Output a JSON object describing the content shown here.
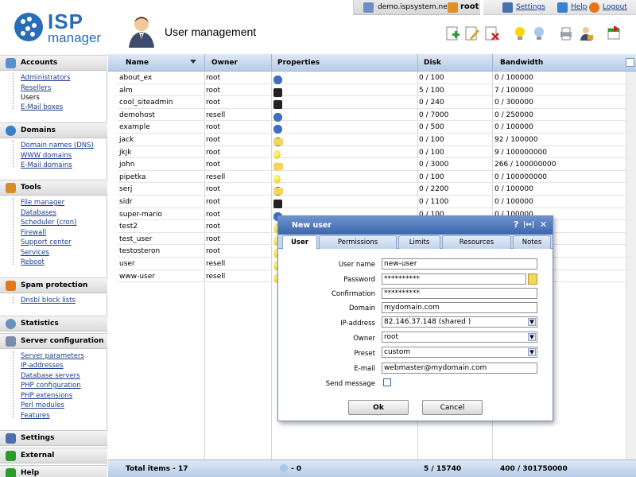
{
  "header": {
    "logo_line1": "ISP",
    "logo_line2": "manager",
    "server": "demo.ispsystem.net ::",
    "user": "root",
    "links": {
      "settings": "Settings",
      "help": "Help",
      "logout": "Logout"
    },
    "page_title": "User management"
  },
  "sidebar": {
    "sections": [
      {
        "title": "Accounts",
        "items": [
          "Administrators",
          "Resellers",
          "Users",
          "E-Mail boxes"
        ],
        "current": "Users"
      },
      {
        "title": "Domains",
        "items": [
          "Domain names (DNS)",
          "WWW domains",
          "E-Mail domains"
        ]
      },
      {
        "title": "Tools",
        "items": [
          "File manager",
          "Databases",
          "Scheduler (cron)",
          "Firewall",
          "Support center",
          "Services",
          "Reboot"
        ]
      },
      {
        "title": "Spam protection",
        "items": [
          "Dnsbl block lists"
        ]
      },
      {
        "title": "Statistics",
        "items": []
      },
      {
        "title": "Server configuration",
        "items": [
          "Server parameters",
          "IP-addresses",
          "Database servers",
          "PHP configuration",
          "PHP extensions",
          "Perl modules",
          "Features"
        ]
      },
      {
        "title": "Settings",
        "items": []
      },
      {
        "title": "External",
        "items": []
      },
      {
        "title": "Help",
        "items": []
      }
    ]
  },
  "grid": {
    "columns": [
      "Name",
      "Owner",
      "Properties",
      "Disk",
      "Bandwidth"
    ],
    "rows": [
      {
        "name": "about_ex",
        "owner": "root",
        "props": [
          "bulb",
          "cgi",
          "php",
          "ssi"
        ],
        "disk": "0 / 100",
        "bw": "0 / 100000"
      },
      {
        "name": "alm",
        "owner": "root",
        "props": [
          "bulb",
          "cgi",
          "php",
          "ssi",
          "ssl",
          "ssh"
        ],
        "disk": "5 / 100",
        "bw": "7 / 100000"
      },
      {
        "name": "cool_siteadmin",
        "owner": "root",
        "props": [
          "bulb",
          "cgi",
          "php",
          "ssi",
          "ssl",
          "ssh"
        ],
        "disk": "0 / 240",
        "bw": "0 / 300000"
      },
      {
        "name": "demohost",
        "owner": "resell",
        "props": [
          "bulb",
          "cgi",
          "php",
          "ssi"
        ],
        "disk": "0 / 7000",
        "bw": "0 / 250000"
      },
      {
        "name": "example",
        "owner": "root",
        "props": [
          "bulb",
          "cgi",
          "php",
          "ssi"
        ],
        "disk": "0 / 500",
        "bw": "0 / 100000"
      },
      {
        "name": "jack",
        "owner": "root",
        "props": [
          "bulb",
          "cgi",
          "php",
          "ssi",
          "fold"
        ],
        "disk": "0 / 100",
        "bw": "92 / 100000"
      },
      {
        "name": "jkjk",
        "owner": "root",
        "props": [
          "bulb"
        ],
        "disk": "0 / 100",
        "bw": "9 / 100000000"
      },
      {
        "name": "john",
        "owner": "root",
        "props": [
          "bulb",
          "fold"
        ],
        "disk": "0 / 3000",
        "bw": "266 / 100000000"
      },
      {
        "name": "pipetka",
        "owner": "resell",
        "props": [
          "bulb"
        ],
        "disk": "0 / 100",
        "bw": "0 / 100000000"
      },
      {
        "name": "serj",
        "owner": "root",
        "props": [
          "bulb",
          "cgi",
          "php",
          "ssi",
          "fold"
        ],
        "disk": "0 / 2200",
        "bw": "0 / 100000"
      },
      {
        "name": "sidr",
        "owner": "root",
        "props": [
          "bulb",
          "cgi",
          "php",
          "ssi",
          "ssl",
          "ssh"
        ],
        "disk": "0 / 1100",
        "bw": "0 / 100000"
      },
      {
        "name": "super-mario",
        "owner": "root",
        "props": [
          "bulb",
          "cgi",
          "php",
          "ssi"
        ],
        "disk": "0 / 100",
        "bw": "0 / 100000"
      },
      {
        "name": "test2",
        "owner": "root",
        "props": [
          "bulb"
        ],
        "disk": "",
        "bw": ""
      },
      {
        "name": "test_user",
        "owner": "root",
        "props": [
          "bulb"
        ],
        "disk": "",
        "bw": ""
      },
      {
        "name": "testosteron",
        "owner": "root",
        "props": [
          "bulb"
        ],
        "disk": "",
        "bw": ""
      },
      {
        "name": "user",
        "owner": "resell",
        "props": [
          "bulb"
        ],
        "disk": "",
        "bw": ""
      },
      {
        "name": "www-user",
        "owner": "resell",
        "props": [
          "bulb"
        ],
        "disk": "",
        "bw": ""
      }
    ],
    "footer": {
      "total": "Total items - 17",
      "props": "- 0",
      "disk": "5 / 15740",
      "bw": "400 / 301750000"
    }
  },
  "dialog": {
    "title": "New user",
    "title_buttons": [
      "?",
      "|↔|",
      "✕"
    ],
    "tabs": [
      "User",
      "Permissions",
      "Limits",
      "Resources",
      "Notes"
    ],
    "active_tab": "User",
    "fields": {
      "username_label": "User name",
      "username": "new-user",
      "password_label": "Password",
      "password": "**********",
      "confirm_label": "Confirmation",
      "confirm": "**********",
      "domain_label": "Domain",
      "domain": "mydomain.com",
      "ip_label": "IP-address",
      "ip": "82.146.37.148 (shared )",
      "owner_label": "Owner",
      "owner": "root",
      "preset_label": "Preset",
      "preset": "custom",
      "email_label": "E-mail",
      "email": "webmaster@mydomain.com",
      "sendmsg_label": "Send message"
    },
    "ok": "Ok",
    "cancel": "Cancel"
  },
  "colors": {
    "accent": "#3c66ad",
    "grid_header": "#b6cbe7",
    "link": "#1a3c8c",
    "logo": "#2a6cb7"
  }
}
